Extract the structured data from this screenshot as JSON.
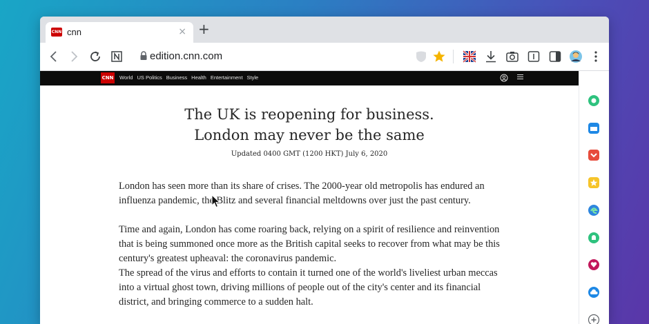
{
  "browser": {
    "tab": {
      "favicon_text": "CNN",
      "title": "cnn",
      "close_glyph": "×"
    },
    "new_tab_glyph": "+",
    "address_bar": {
      "url": "edition.cnn.com"
    }
  },
  "cnn_nav": {
    "logo_text": "CNN",
    "links": [
      "World",
      "US Politics",
      "Business",
      "Health",
      "Entertainment",
      "Style"
    ]
  },
  "article": {
    "headline_line1": "The UK is reopening for business.",
    "headline_line2": "London may never be the same",
    "updated": "Updated 0400 GMT (1200 HKT) July 6, 2020",
    "paragraphs": [
      "London has seen more than its share of crises. The 2000-year old metropolis has endured an influenza pandemic, the Blitz and several financial meltdowns over just the past century.",
      "Time and again, London has come roaring back, relying on a spirit of resilience and reinvention that is being summoned once more as the British capital seeks to recover from what may be this century's greatest upheaval: the coronavirus pandemic.",
      "The spread of the virus and efforts to contain it turned one of the world's liveliest urban meccas into a virtual ghost town, driving millions of people out of the city's center and its financial district, and bringing commerce to a sudden halt."
    ]
  },
  "sidebar": {
    "icons": [
      "chat-icon",
      "calendar-icon",
      "pocket-icon",
      "bookmark-star-icon",
      "edge-icon",
      "notification-bell-icon",
      "heart-icon",
      "cloud-icon",
      "add-icon"
    ],
    "colors": [
      "#2ec27e",
      "#1e88e5",
      "#e74c3c",
      "#f6c42a",
      "#2e86de",
      "#2ec27e",
      "#c2185b",
      "#1e88e5"
    ],
    "add_glyph": "+"
  },
  "colors": {
    "cnn_red": "#cc0000",
    "star": "#f5b400"
  }
}
